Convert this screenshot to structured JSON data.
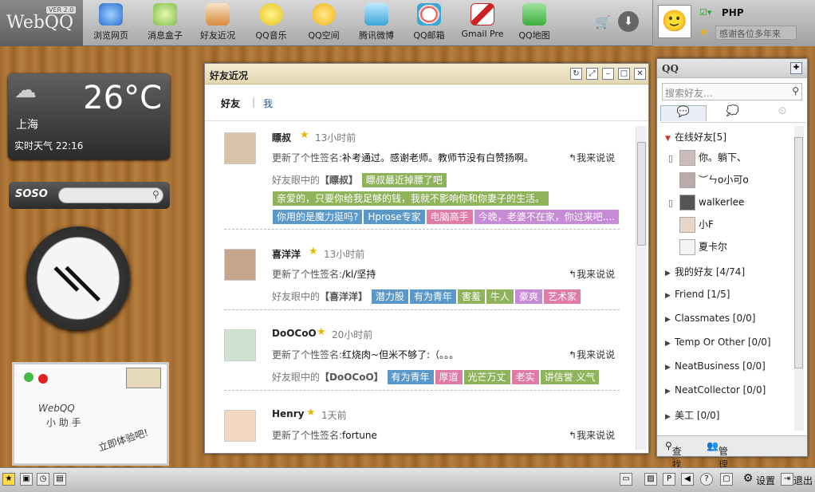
{
  "brand": {
    "name": "WebQQ",
    "version": "VER 2.0"
  },
  "apps": [
    {
      "label": "浏览网页",
      "icon": "browser-icon",
      "color": "#3b8fdc"
    },
    {
      "label": "消息盒子",
      "icon": "message-box-icon",
      "color": "#7fc04a"
    },
    {
      "label": "好友近况",
      "icon": "friend-news-icon",
      "color": "#d9893a"
    },
    {
      "label": "QQ音乐",
      "icon": "qq-music-icon",
      "color": "#e8c21c"
    },
    {
      "label": "QQ空间",
      "icon": "qzone-icon",
      "color": "#f2b21a"
    },
    {
      "label": "腾讯微博",
      "icon": "weibo-icon",
      "color": "#3aa7d6"
    },
    {
      "label": "QQ邮箱",
      "icon": "qq-mail-icon",
      "color": "#dd3a2c"
    },
    {
      "label": "Gmail Pre",
      "icon": "gmail-icon",
      "color": "#cc2222"
    },
    {
      "label": "QQ地图",
      "icon": "qq-map-icon",
      "color": "#3cae3c"
    }
  ],
  "profile": {
    "name": "PHP",
    "signature": "感谢各位多年来"
  },
  "weather": {
    "temperature": "26°C",
    "city": "上海",
    "desc": "实时天气 22:16"
  },
  "soso": {
    "logo": "SOSO"
  },
  "assistant": {
    "line1": "WebQQ",
    "line2": "小 助 手",
    "cta": "立即体验吧!"
  },
  "window": {
    "title": "好友近况",
    "tabs": [
      "好友",
      "我"
    ],
    "signature_prefix": "更新了个性签名:",
    "reply_label": "我来说说",
    "eyes_prefix": "好友眼中的",
    "entries": [
      {
        "name": "瞟叔",
        "time": "13小时前",
        "signature": "补考通过。感谢老师。教师节没有白赞扬啊。",
        "bracket_name": "【瞟叔】",
        "tags": [
          {
            "text": "瞟叔最近掉膘了吧",
            "color": "#8fb35a"
          },
          {
            "text": "亲爱的，只要你给我足够的钱，我就不影响你和你妻子的生活。",
            "color": "#8fb35a"
          },
          {
            "text": "你用的是魔力挺吗?",
            "color": "#5a98c9"
          },
          {
            "text": "Hprose专家",
            "color": "#5a98c9"
          },
          {
            "text": "电脑高手",
            "color": "#e07aa6"
          },
          {
            "text": "今晚，老婆不在家，你过来吧....",
            "color": "#c78ad6"
          }
        ]
      },
      {
        "name": "喜洋洋",
        "time": "13小时前",
        "signature": "/kl/坚持",
        "bracket_name": "【喜洋洋】",
        "tags": [
          {
            "text": "潜力股",
            "color": "#5a98c9"
          },
          {
            "text": "有为青年",
            "color": "#5a98c9"
          },
          {
            "text": "害羞",
            "color": "#8fb35a"
          },
          {
            "text": "牛人",
            "color": "#8fb35a"
          },
          {
            "text": "豪爽",
            "color": "#c78ad6"
          },
          {
            "text": "艺术家",
            "color": "#e07aa6"
          }
        ]
      },
      {
        "name": "DoOCoO",
        "time": "20小时前",
        "signature": "红烧肉~但米不够了:（。。。",
        "bracket_name": "【DoOCoO】",
        "tags": [
          {
            "text": "有为青年",
            "color": "#5a98c9"
          },
          {
            "text": "厚道",
            "color": "#e07aa6"
          },
          {
            "text": "光芒万丈",
            "color": "#8fb35a"
          },
          {
            "text": "老实",
            "color": "#e07aa6"
          },
          {
            "text": "讲信誉 义气",
            "color": "#8fb35a"
          }
        ]
      },
      {
        "name": "Henry",
        "time": "1天前",
        "signature": "fortune",
        "bracket_name": "",
        "tags": []
      }
    ]
  },
  "qqpanel": {
    "title": "QQ",
    "search_placeholder": "搜索好友...",
    "online_group": "在线好友[5]",
    "online_friends": [
      {
        "name": "你。躺下、",
        "phone": true
      },
      {
        "name": "︶ㄣo小可o",
        "phone": false
      },
      {
        "name": "walkerlee",
        "phone": true
      },
      {
        "name": "小F",
        "phone": false
      },
      {
        "name": "夏卡尔",
        "phone": false
      }
    ],
    "groups": [
      "我的好友 [4/74]",
      "Friend [1/5]",
      "Classmates [0/0]",
      "Temp Or Other [0/0]",
      "NeatBusiness [0/0]",
      "NeatCollector [0/0]",
      "美工 [0/0]"
    ],
    "find_label": "查找",
    "manage_label": "管理"
  },
  "taskbar": {
    "settings_label": "设置",
    "exit_label": "退出"
  }
}
